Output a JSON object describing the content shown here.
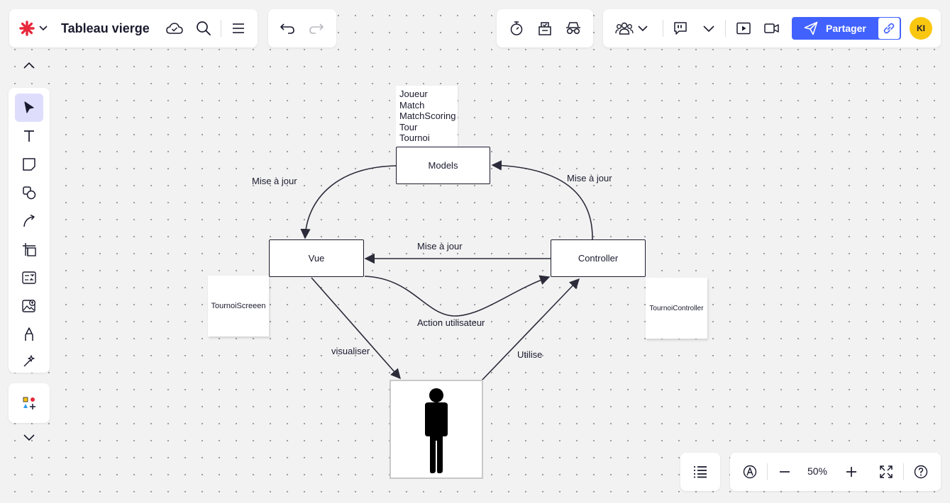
{
  "board": {
    "title": "Tableau vierge"
  },
  "header": {
    "share_label": "Partager",
    "avatar_initials": "KI"
  },
  "zoom": {
    "level": "50%"
  },
  "diagram": {
    "boxes": {
      "models": "Models",
      "vue": "Vue",
      "controller": "Controller"
    },
    "models_list": [
      "Joueur",
      "Match",
      "MatchScoring",
      "Tour",
      "Tournoi"
    ],
    "stickies": {
      "vue_note": "TournoiScreeen",
      "controller_note": "TournoiController"
    },
    "labels": {
      "models_to_vue": "Mise à jour",
      "controller_to_models": "Mise à jour",
      "controller_to_vue": "Mise à jour",
      "user_action": "Action utilisateur",
      "visualize": "visualiser",
      "uses": "Utilise"
    }
  },
  "colors": {
    "accent": "#4262ff",
    "avatar": "#fac710",
    "logo": "#e8283c",
    "active_tool": "#dedefc"
  }
}
